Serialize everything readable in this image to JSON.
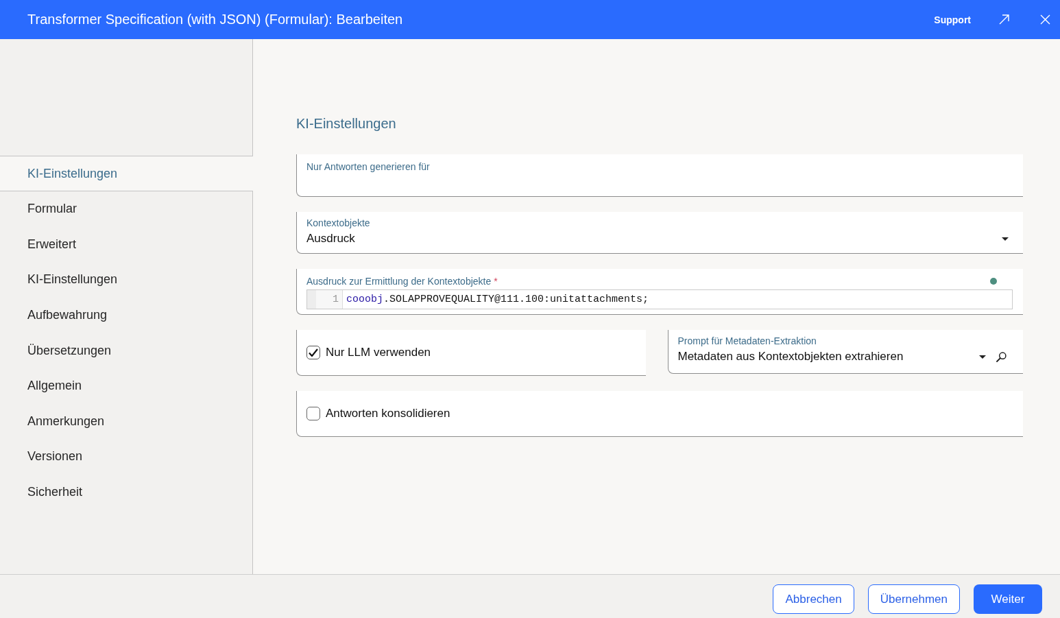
{
  "window": {
    "title": "Transformer Specification (with JSON) (Formular): Bearbeiten",
    "support": "Support"
  },
  "sidebar": {
    "items": [
      {
        "label": "KI-Einstellungen",
        "selected": true
      },
      {
        "label": "Formular",
        "selected": false
      },
      {
        "label": "Erweitert",
        "selected": false
      },
      {
        "label": "KI-Einstellungen",
        "selected": false
      },
      {
        "label": "Aufbewahrung",
        "selected": false
      },
      {
        "label": "Übersetzungen",
        "selected": false
      },
      {
        "label": "Allgemein",
        "selected": false
      },
      {
        "label": "Anmerkungen",
        "selected": false
      },
      {
        "label": "Versionen",
        "selected": false
      },
      {
        "label": "Sicherheit",
        "selected": false
      }
    ]
  },
  "section": {
    "title": "KI-Einstellungen",
    "rows": [
      {
        "fields": [
          {
            "kind": "text",
            "label": "Nur Antworten generieren für"
          }
        ]
      },
      {
        "fields": [
          {
            "kind": "select",
            "label": "Kontextobjekte",
            "value": "Ausdruck"
          }
        ]
      },
      {
        "fields": [
          {
            "kind": "code",
            "label": "Ausdruck zur Ermittlung der Kontextobjekte",
            "required_mark": "*",
            "lines": [
              {
                "number": "1",
                "tokens": [
                  {
                    "kind": "variable",
                    "text": "cooobj"
                  },
                  {
                    "kind": "plain",
                    "text": ".SOLAPPROVEQUALITY@111.100:unitattachments;"
                  }
                ]
              }
            ]
          }
        ]
      },
      {
        "fields": [
          {
            "kind": "checkbox",
            "label": "Nur LLM verwenden",
            "checked": true
          },
          {
            "kind": "lookup",
            "label": "Prompt für Metadaten-Extraktion",
            "value": "Metadaten aus Kontextobjekten extrahieren"
          }
        ]
      },
      {
        "fields": [
          {
            "kind": "checkbox",
            "label": "Antworten konsolidieren",
            "checked": false
          }
        ]
      }
    ]
  },
  "footer": {
    "buttons": [
      {
        "label": "Abbrechen",
        "kind": "secondary"
      },
      {
        "label": "Übernehmen",
        "kind": "secondary"
      },
      {
        "label": "Weiter",
        "kind": "primary"
      }
    ]
  }
}
